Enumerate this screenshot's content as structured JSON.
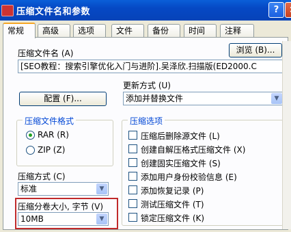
{
  "window": {
    "title": "压缩文件名和参数",
    "help_glyph": "?",
    "close_glyph": "×"
  },
  "tabs": [
    "常规",
    "高级",
    "选项",
    "文件",
    "备份",
    "时间",
    "注释"
  ],
  "archive_name": {
    "label": "压缩文件名 (A)",
    "browse_label": "浏览 (B)...",
    "value": "[SEO教程：搜索引擎优化入门与进阶].吴泽欣.扫描版(ED2000.C"
  },
  "profiles_button": "配置 (F)...",
  "update_mode": {
    "label": "更新方式 (U)",
    "value": "添加并替换文件"
  },
  "archive_format": {
    "title": "压缩文件格式",
    "options": [
      {
        "label": "RAR (R)",
        "selected": true
      },
      {
        "label": "ZIP (Z)",
        "selected": false
      }
    ]
  },
  "compression_method": {
    "label": "压缩方式 (C)",
    "value": "标准"
  },
  "volume_size": {
    "label": "压缩分卷大小, 字节 (V)",
    "value": "10MB"
  },
  "archive_options": {
    "title": "压缩选项",
    "items": [
      "压缩后删除源文件 (L)",
      "创建自解压格式压缩文件 (X)",
      "创建固实压缩文件 (S)",
      "添加用户身份校验信息 (E)",
      "添加恢复记录 (P)",
      "测试压缩文件 (T)",
      "锁定压缩文件 (K)"
    ]
  },
  "colors": {
    "titlebar": "#0548c4",
    "highlight": "#c0292a",
    "group_title": "#0046d5"
  }
}
